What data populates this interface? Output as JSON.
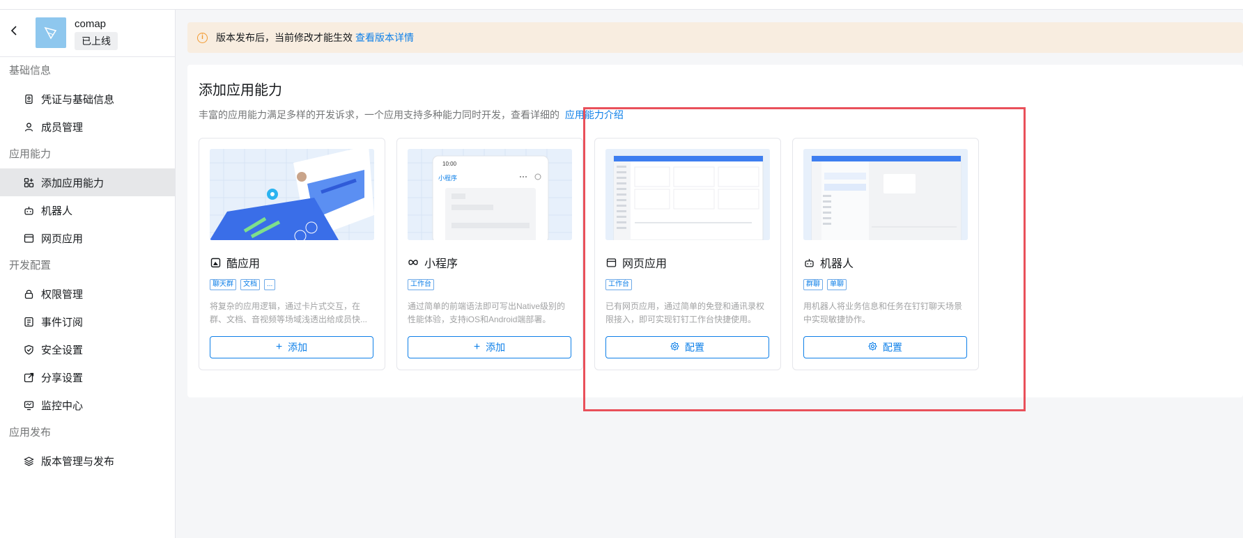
{
  "app": {
    "name": "comap",
    "status": "已上线"
  },
  "sidebar": {
    "groups": [
      {
        "title": "基础信息",
        "items": [
          {
            "label": "凭证与基础信息",
            "icon": "credential-icon"
          },
          {
            "label": "成员管理",
            "icon": "user-icon"
          }
        ]
      },
      {
        "title": "应用能力",
        "items": [
          {
            "label": "添加应用能力",
            "icon": "grid-add-icon",
            "active": true
          },
          {
            "label": "机器人",
            "icon": "robot-icon"
          },
          {
            "label": "网页应用",
            "icon": "browser-icon"
          }
        ]
      },
      {
        "title": "开发配置",
        "items": [
          {
            "label": "权限管理",
            "icon": "lock-icon"
          },
          {
            "label": "事件订阅",
            "icon": "event-icon"
          },
          {
            "label": "安全设置",
            "icon": "shield-icon"
          },
          {
            "label": "分享设置",
            "icon": "share-icon"
          },
          {
            "label": "监控中心",
            "icon": "monitor-icon"
          }
        ]
      },
      {
        "title": "应用发布",
        "items": [
          {
            "label": "版本管理与发布",
            "icon": "layers-icon"
          }
        ]
      }
    ]
  },
  "notice": {
    "text": "版本发布后，当前修改才能生效",
    "link": "查看版本详情"
  },
  "main": {
    "title": "添加应用能力",
    "desc": "丰富的应用能力满足多样的开发诉求，一个应用支持多种能力同时开发，查看详细的",
    "desc_link": "应用能力介绍",
    "cards": [
      {
        "title": "酷应用",
        "tags": [
          "聊天群",
          "文档",
          "..."
        ],
        "desc": "将复杂的应用逻辑，通过卡片式交互，在群、文档、音视频等场域浅透出给成员快...",
        "button": "添加",
        "button_icon": "plus-icon"
      },
      {
        "title": "小程序",
        "tags": [
          "工作台"
        ],
        "desc": "通过简单的前端语法即可写出Native级别的性能体验，支持iOS和Android端部署。",
        "button": "添加",
        "button_icon": "plus-icon",
        "thumb": {
          "time": "10:00",
          "title": "小程序"
        }
      },
      {
        "title": "网页应用",
        "tags": [
          "工作台"
        ],
        "desc": "已有网页应用，通过简单的免登和通讯录权限接入，即可实现钉钉工作台快捷使用。",
        "button": "配置",
        "button_icon": "gear-icon"
      },
      {
        "title": "机器人",
        "tags": [
          "群聊",
          "单聊"
        ],
        "desc": "用机器人将业务信息和任务在钉钉聊天场景中实现敏捷协作。",
        "button": "配置",
        "button_icon": "gear-icon"
      }
    ]
  },
  "colors": {
    "accent": "#0d7fe8",
    "highlight": "#e9505a",
    "notice_bg": "#f8ede0"
  }
}
